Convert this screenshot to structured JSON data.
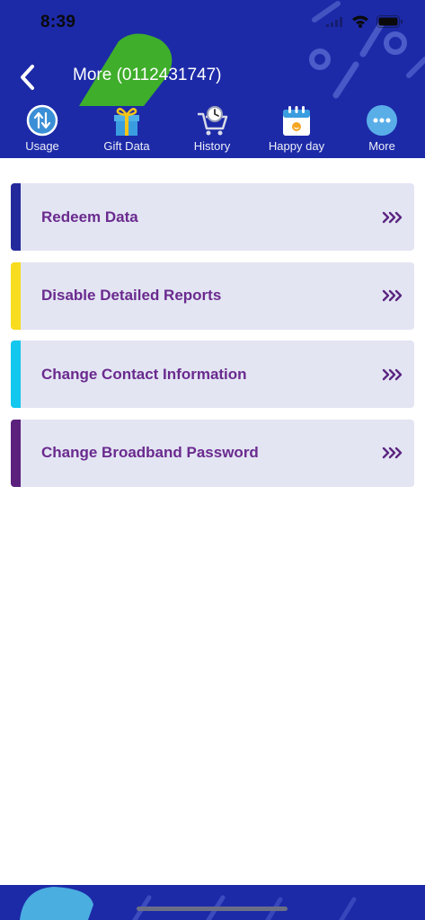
{
  "status_bar": {
    "time": "8:39"
  },
  "header": {
    "title": "More (0112431747)"
  },
  "tabs": [
    {
      "label": "Usage",
      "icon": "usage-icon"
    },
    {
      "label": "Gift Data",
      "icon": "gift-icon"
    },
    {
      "label": "History",
      "icon": "history-icon"
    },
    {
      "label": "Happy day",
      "icon": "calendar-icon"
    },
    {
      "label": "More",
      "icon": "more-icon"
    }
  ],
  "menu": [
    {
      "label": "Redeem Data",
      "accent": "#23299b"
    },
    {
      "label": "Disable Detailed Reports",
      "accent": "#f7dc1f"
    },
    {
      "label": "Change Contact Information",
      "accent": "#13c7ef"
    },
    {
      "label": "Change Broadband Password",
      "accent": "#5b217d"
    }
  ],
  "colors": {
    "header_bg": "#1c2aa8",
    "menu_bg": "#e3e5f3",
    "menu_text": "#6a2a8e"
  }
}
